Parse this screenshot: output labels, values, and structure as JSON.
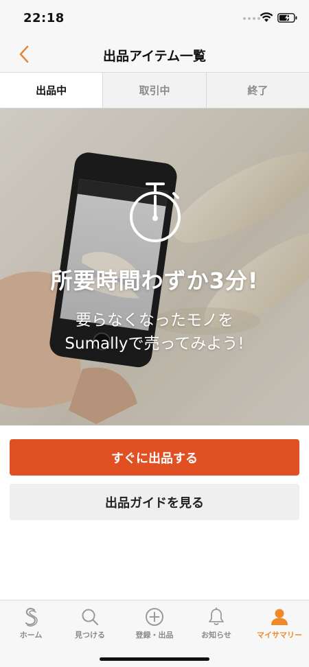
{
  "status_bar": {
    "time": "22:18"
  },
  "nav": {
    "title": "出品アイテム一覧"
  },
  "tabs": [
    {
      "label": "出品中",
      "active": true
    },
    {
      "label": "取引中",
      "active": false
    },
    {
      "label": "終了",
      "active": false
    }
  ],
  "hero": {
    "headline": "所要時間わずか3分!",
    "sub_line1": "要らなくなったモノを",
    "sub_line2": "Sumallyで売ってみよう!"
  },
  "actions": {
    "primary_label": "すぐに出品する",
    "secondary_label": "出品ガイドを見る"
  },
  "tab_bar": {
    "items": [
      {
        "label": "ホーム",
        "icon": "sumally-logo-icon"
      },
      {
        "label": "見つける",
        "icon": "search-icon"
      },
      {
        "label": "登録・出品",
        "icon": "plus-circle-icon"
      },
      {
        "label": "お知らせ",
        "icon": "bell-icon"
      },
      {
        "label": "マイサマリー",
        "icon": "person-icon",
        "active": true
      }
    ]
  },
  "colors": {
    "accent": "#e05022",
    "active_tab": "#ee8a2a",
    "back_arrow": "#e08a3a"
  }
}
